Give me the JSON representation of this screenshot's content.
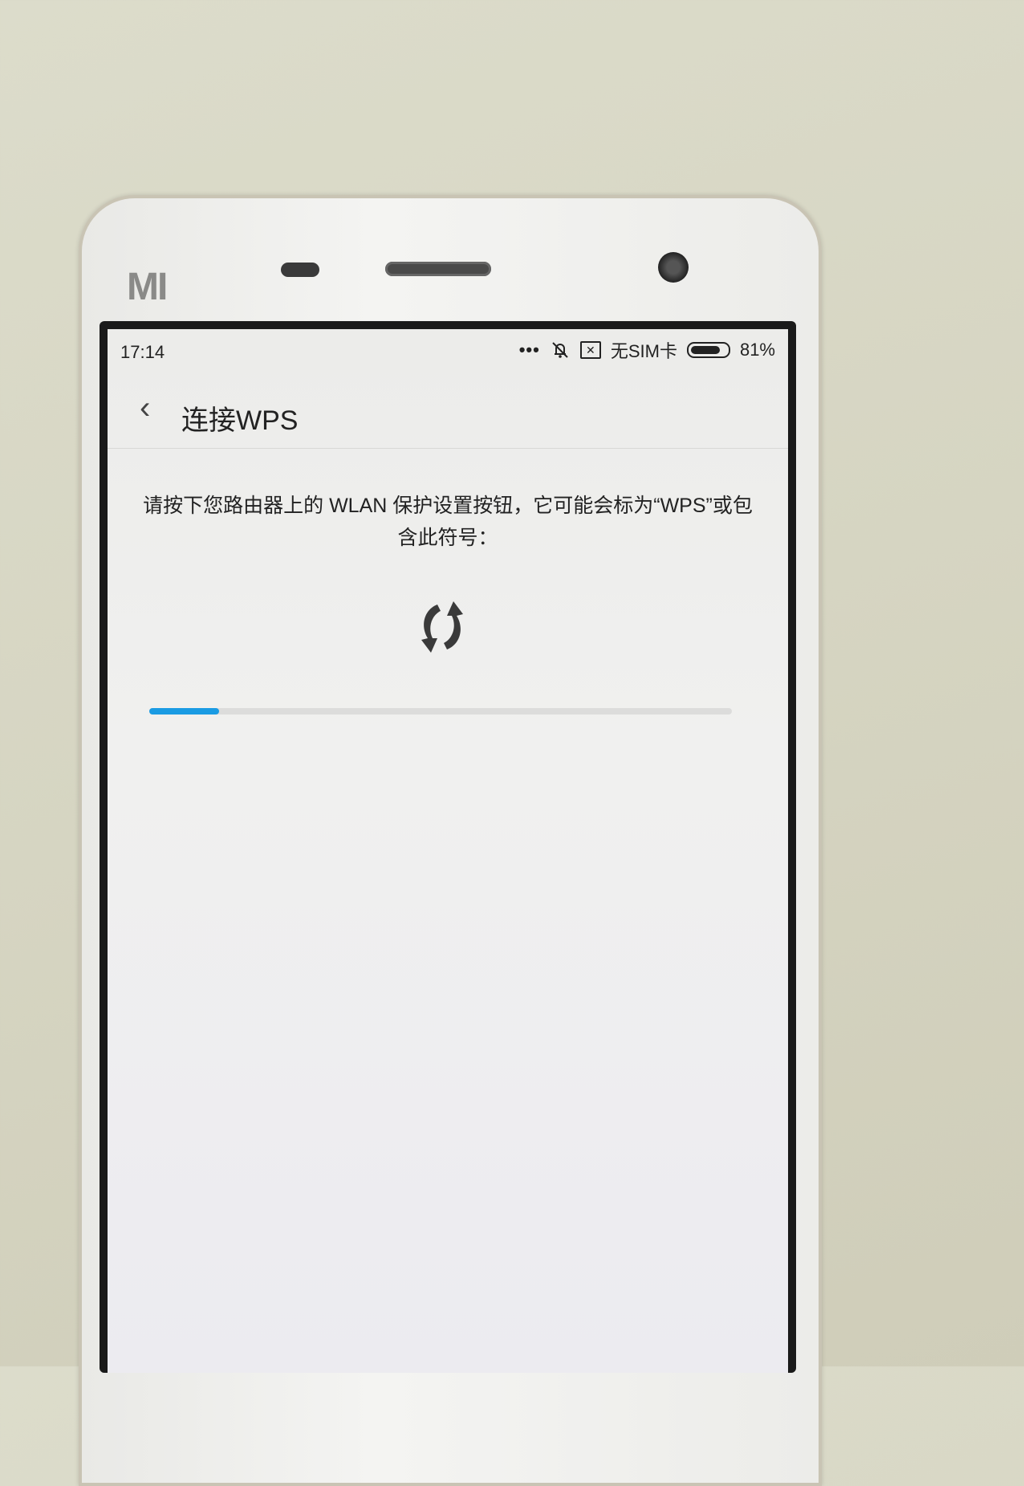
{
  "device": {
    "brand_logo": "MI"
  },
  "status_bar": {
    "time": "17:14",
    "more_indicator": "•••",
    "icons": [
      "silent-bell-icon",
      "no-sim-icon",
      "battery-icon"
    ],
    "sim_status": "无SIM卡",
    "battery_percent": 81,
    "battery_label": "81%"
  },
  "header": {
    "back_icon": "‹",
    "title": "连接WPS"
  },
  "main": {
    "instruction": "请按下您路由器上的 WLAN 保护设置按钮，它可能会标为“WPS”或包含此符号：",
    "symbol_icon": "wps-icon",
    "progress_percent": 12,
    "accent_color": "#1a9be3"
  }
}
